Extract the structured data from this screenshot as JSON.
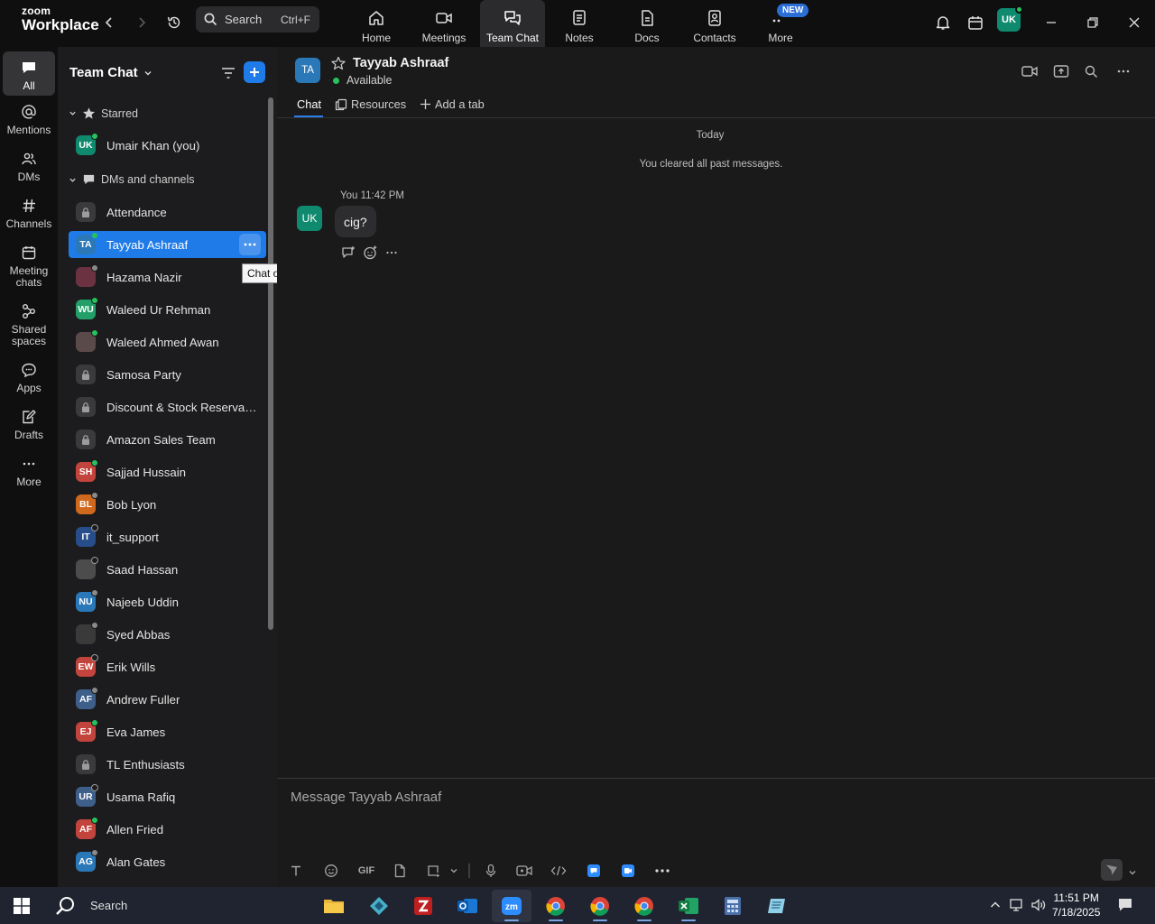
{
  "app": {
    "logo_line1": "zoom",
    "logo_line2": "Workplace"
  },
  "search": {
    "label": "Search",
    "shortcut": "Ctrl+F"
  },
  "nav_tabs": [
    {
      "label": "Home",
      "icon": "home-icon"
    },
    {
      "label": "Meetings",
      "icon": "video-camera-icon"
    },
    {
      "label": "Team Chat",
      "icon": "chat-bubbles-icon",
      "active": true
    },
    {
      "label": "Notes",
      "icon": "notes-icon"
    },
    {
      "label": "Docs",
      "icon": "document-icon"
    },
    {
      "label": "Contacts",
      "icon": "contact-card-icon"
    },
    {
      "label": "More",
      "icon": "more-dots-icon",
      "badge": "NEW"
    }
  ],
  "user": {
    "initials": "UK"
  },
  "rail": [
    {
      "label": "All",
      "active": true
    },
    {
      "label": "Mentions"
    },
    {
      "label": "DMs"
    },
    {
      "label": "Channels"
    },
    {
      "label": "Meeting chats"
    },
    {
      "label": "Shared spaces"
    },
    {
      "label": "Apps"
    },
    {
      "label": "Drafts"
    },
    {
      "label": "More"
    }
  ],
  "list": {
    "title": "Team Chat",
    "starred_label": "Starred",
    "starred": [
      {
        "name": "Umair Khan (you)",
        "initials": "UK",
        "color": "#0f8a6e",
        "presence": "online"
      }
    ],
    "dms_label": "DMs and channels",
    "dms": [
      {
        "name": "Attendance",
        "type": "channel"
      },
      {
        "name": "Tayyab Ashraaf",
        "initials": "TA",
        "color": "#2a78b8",
        "presence": "online",
        "selected": true
      },
      {
        "name": "Hazama Nazir",
        "initials": "",
        "color": "#6b3342",
        "presence": "away",
        "photo": true
      },
      {
        "name": "Waleed Ur Rehman",
        "initials": "WU",
        "color": "#23a06a",
        "presence": "online"
      },
      {
        "name": "Waleed Ahmed Awan",
        "initials": "",
        "color": "#5b4a4a",
        "presence": "online",
        "photo": true
      },
      {
        "name": "Samosa Party",
        "type": "channel"
      },
      {
        "name": "Discount & Stock Reservati...",
        "type": "channel"
      },
      {
        "name": "Amazon Sales Team",
        "type": "channel"
      },
      {
        "name": "Sajjad Hussain",
        "initials": "SH",
        "color": "#c2443c",
        "presence": "online"
      },
      {
        "name": "Bob Lyon",
        "initials": "BL",
        "color": "#d0681e",
        "presence": "away"
      },
      {
        "name": "it_support",
        "initials": "IT",
        "color": "#274d8a",
        "presence": "ring",
        "photo": true
      },
      {
        "name": "Saad Hassan",
        "initials": "",
        "color": "#4c4c4c",
        "presence": "ring",
        "photo": true
      },
      {
        "name": "Najeeb Uddin",
        "initials": "NU",
        "color": "#2a78b8",
        "presence": "away"
      },
      {
        "name": "Syed Abbas",
        "initials": "",
        "color": "#3a3a3a",
        "presence": "away",
        "photo": true
      },
      {
        "name": "Erik Wills",
        "initials": "EW",
        "color": "#c2443c",
        "presence": "ring"
      },
      {
        "name": "Andrew Fuller",
        "initials": "AF",
        "color": "#3d5f8a",
        "presence": "away"
      },
      {
        "name": "Eva James",
        "initials": "EJ",
        "color": "#c2443c",
        "presence": "online"
      },
      {
        "name": "TL Enthusiasts",
        "type": "channel"
      },
      {
        "name": "Usama Rafiq",
        "initials": "UR",
        "color": "#3d5f8a",
        "presence": "ring"
      },
      {
        "name": "Allen Fried",
        "initials": "AF",
        "color": "#c2443c",
        "presence": "online"
      },
      {
        "name": "Alan Gates",
        "initials": "AG",
        "color": "#2a78b8",
        "presence": "away"
      }
    ],
    "tooltip": "Chat options"
  },
  "chat": {
    "initials": "TA",
    "name": "Tayyab Ashraaf",
    "status": "Available",
    "tabs": [
      {
        "label": "Chat",
        "active": true
      },
      {
        "label": "Resources"
      },
      {
        "label": "Add a tab"
      }
    ],
    "day": "Today",
    "cleared": "You cleared all past messages.",
    "message": {
      "author_initials": "UK",
      "sender": "You",
      "time": "11:42 PM",
      "text": "cig?"
    },
    "compose_placeholder": "Message Tayyab Ashraaf",
    "gif_label": "GIF"
  },
  "taskbar": {
    "search_label": "Search",
    "time": "11:51 PM",
    "date": "7/18/2025"
  },
  "colors": {
    "accent": "#1e7be8",
    "online": "#27c25c",
    "sidebar_bg": "#1c1c1e",
    "topbar_bg": "#0f0f10"
  }
}
